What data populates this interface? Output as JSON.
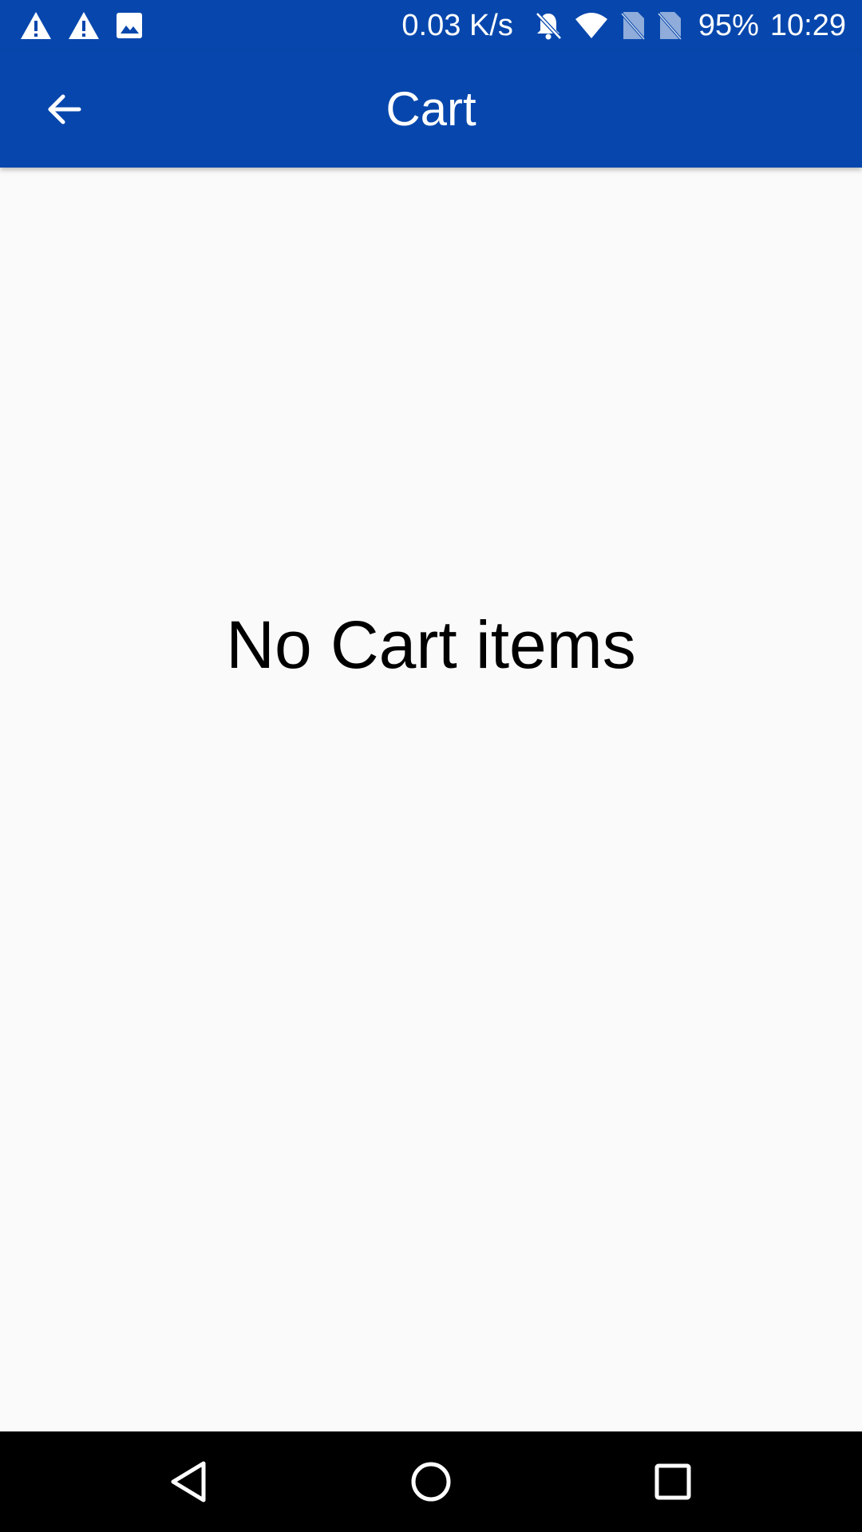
{
  "status_bar": {
    "net_speed": "0.03 K/s",
    "battery": "95%",
    "time": "10:29",
    "left_icons": [
      "warning-icon",
      "warning-icon",
      "image-icon"
    ],
    "right_icons": [
      "notifications-off-icon",
      "wifi-icon",
      "no-sim-icon",
      "no-sim-icon"
    ]
  },
  "app_bar": {
    "title": "Cart",
    "back_icon": "arrow-back-icon"
  },
  "main": {
    "empty_message": "No Cart items"
  },
  "nav_bar": {
    "icons": [
      "back-triangle-icon",
      "home-circle-icon",
      "recents-square-icon"
    ]
  },
  "colors": {
    "primary": "#0747ad",
    "background": "#fafafa",
    "nav_background": "#000000"
  }
}
